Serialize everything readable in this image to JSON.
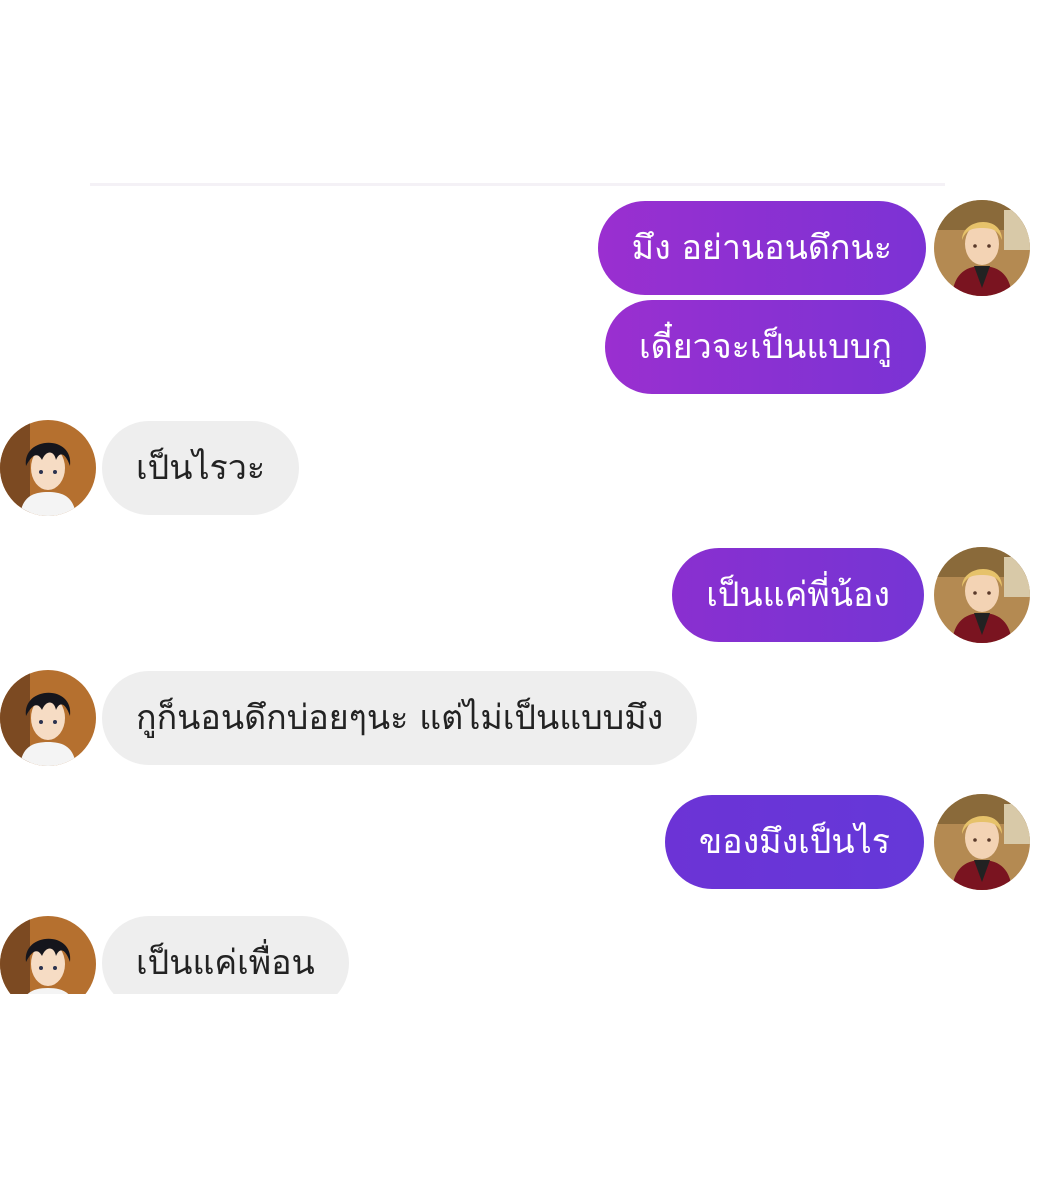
{
  "theme": {
    "purple_start": "#8b2bd0",
    "purple_end": "#6a33d6",
    "gray_bubble": "#eeeeee"
  },
  "messages": [
    {
      "side": "outgoing",
      "sender": "blonde-character",
      "text": "มึง อย่านอนดึกนะ"
    },
    {
      "side": "outgoing",
      "sender": "blonde-character",
      "text": "เดี๋ยวจะเป็นแบบกู"
    },
    {
      "side": "incoming",
      "sender": "dark-haired-character",
      "text": "เป็นไรวะ"
    },
    {
      "side": "outgoing",
      "sender": "blonde-character",
      "text": "เป็นแค่พี่น้อง"
    },
    {
      "side": "incoming",
      "sender": "dark-haired-character",
      "text": "กูก็นอนดึกบ่อยๆนะ แต่ไม่เป็นแบบมึง"
    },
    {
      "side": "outgoing",
      "sender": "blonde-character",
      "text": "ของมึงเป็นไร"
    },
    {
      "side": "incoming",
      "sender": "dark-haired-character",
      "text": "เป็นแค่เพื่อน"
    }
  ]
}
